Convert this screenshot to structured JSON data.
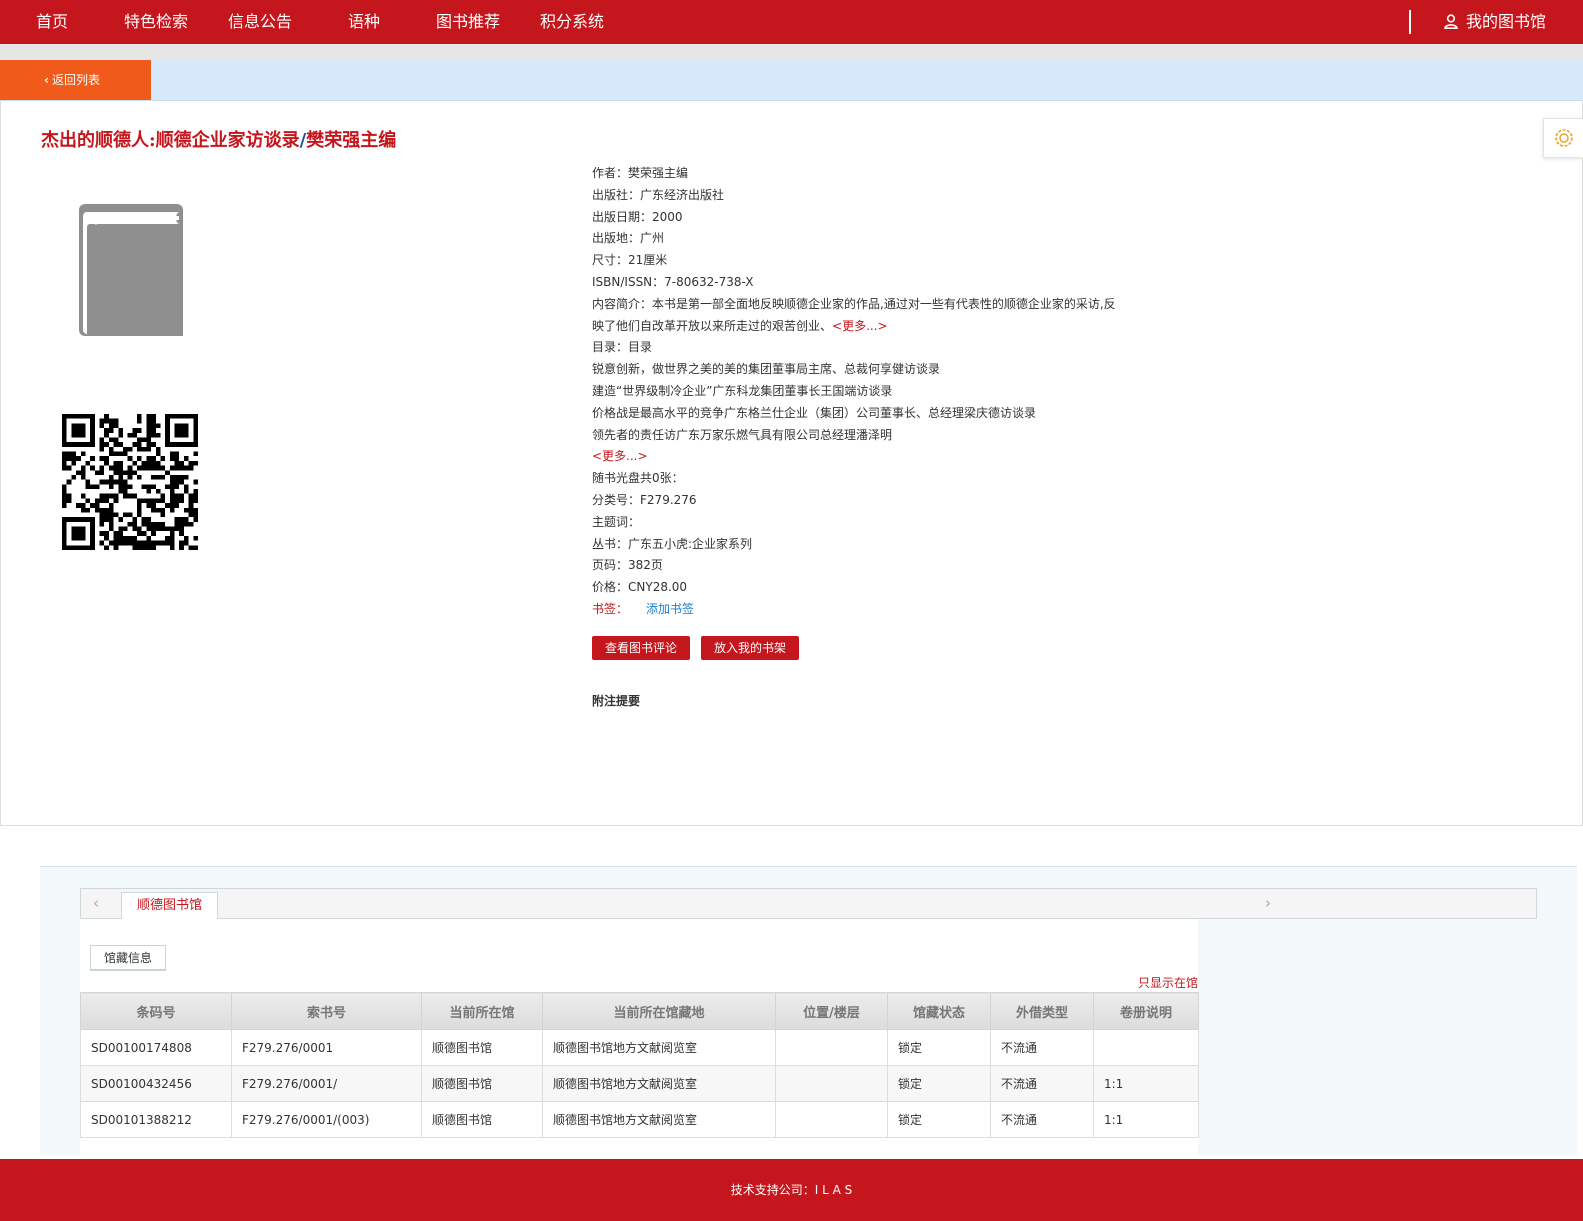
{
  "nav": {
    "items": [
      "首页",
      "特色检索",
      "信息公告",
      "语种",
      "图书推荐",
      "积分系统"
    ],
    "my_library": "我的图书馆"
  },
  "back": {
    "label": "返回列表"
  },
  "book": {
    "title": "杰出的顺德人:顺德企业家访谈录",
    "title_sep": "/",
    "title_author": "樊荣强主编"
  },
  "info": {
    "author_label": "作者：",
    "author": "樊荣强主编",
    "publisher_label": "出版社：",
    "publisher": "广东经济出版社",
    "pubdate_label": "出版日期：",
    "pubdate": "2000",
    "place_label": "出版地：",
    "place": "广州",
    "size_label": "尺寸：",
    "size": "21厘米",
    "isbn_label": "ISBN/ISSN：",
    "isbn": "7-80632-738-X",
    "summary_label": "内容简介：",
    "summary_line1": "本书是第一部全面地反映顺德企业家的作品,通过对一些有代表性的顺德企业家的采访,反",
    "summary_line2": "映了他们自改革开放以来所走过的艰苦创业、",
    "more": "<更多...>",
    "toc_label": "目录：",
    "toc": "目录",
    "toc_lines": [
      "锐意创新，做世界之美的美的集团董事局主席、总裁何享健访谈录",
      "建造“世界级制冷企业”广东科龙集团董事长王国端访谈录",
      "价格战是最高水平的竞争广东格兰仕企业（集团）公司董事长、总经理梁庆德访谈录",
      "领先者的责任访广东万家乐燃气具有限公司总经理潘泽明"
    ],
    "toc_more": "<更多...>",
    "cd": "随书光盘共0张：",
    "class_label": "分类号：",
    "class_no": "F279.276",
    "subject_label": "主题词：",
    "series_label": "丛书：",
    "series": "广东五小虎:企业家系列",
    "pages_label": "页码：",
    "pages": "382页",
    "price_label": "价格：",
    "price": "CNY28.00",
    "bookmark_label": "书签：",
    "bookmark_add": "添加书签"
  },
  "buttons": {
    "review": "查看图书评论",
    "shelf": "放入我的书架"
  },
  "note_title": "附注提要",
  "holdings": {
    "tab": "顺德图书馆",
    "subtab": "馆藏信息",
    "only_link": "只显示在馆",
    "columns": [
      "条码号",
      "索书号",
      "当前所在馆",
      "当前所在馆藏地",
      "位置/楼层",
      "馆藏状态",
      "外借类型",
      "卷册说明"
    ],
    "rows": [
      [
        "SD00100174808",
        "F279.276/0001",
        "顺德图书馆",
        "顺德图书馆地方文献阅览室",
        "",
        "锁定",
        "不流通",
        ""
      ],
      [
        "SD00100432456",
        "F279.276/0001/",
        "顺德图书馆",
        "顺德图书馆地方文献阅览室",
        "",
        "锁定",
        "不流通",
        "1:1"
      ],
      [
        "SD00101388212",
        "F279.276/0001/(003)",
        "顺德图书馆",
        "顺德图书馆地方文献阅览室",
        "",
        "锁定",
        "不流通",
        "1:1"
      ]
    ]
  },
  "footer": "技术支持公司：I L A S",
  "colors": {
    "brand_red": "#c4161c",
    "back_orange": "#f05a1a",
    "info_blue": "#d6e9fb"
  }
}
